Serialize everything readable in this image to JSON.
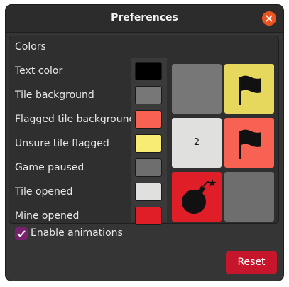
{
  "window": {
    "title": "Preferences"
  },
  "colors_section": {
    "heading": "Colors",
    "rows": [
      {
        "label": "Text color",
        "swatch": "#000000"
      },
      {
        "label": "Tile background",
        "swatch": "#777777"
      },
      {
        "label": "Flagged tile background",
        "swatch": "#f76252"
      },
      {
        "label": "Unsure tile flagged",
        "swatch": "#f8ec74"
      },
      {
        "label": "Game paused",
        "swatch": "#6e6e6e"
      },
      {
        "label": "Tile opened",
        "swatch": "#e0e0de"
      },
      {
        "label": "Mine opened",
        "swatch": "#e01e27"
      }
    ]
  },
  "preview": {
    "tiles": [
      {
        "name": "plain-tile",
        "color": "#777777",
        "content": ""
      },
      {
        "name": "unsure-flag-tile",
        "color": "#e6d85c",
        "content": "flag-icon"
      },
      {
        "name": "opened-number-tile",
        "color": "#e0e0de",
        "content": "2"
      },
      {
        "name": "flagged-tile",
        "color": "#f76252",
        "content": "flag-icon"
      },
      {
        "name": "mine-tile",
        "color": "#e01e27",
        "content": "bomb-icon"
      },
      {
        "name": "paused-tile",
        "color": "#6e6e6e",
        "content": ""
      }
    ]
  },
  "options": {
    "enable_animations": "Enable animations",
    "enable_animations_checked": true
  },
  "actions": {
    "reset": "Reset"
  },
  "accent": {
    "close": "#e95420",
    "checkbox": "#77216f",
    "reset": "#c7162b"
  }
}
